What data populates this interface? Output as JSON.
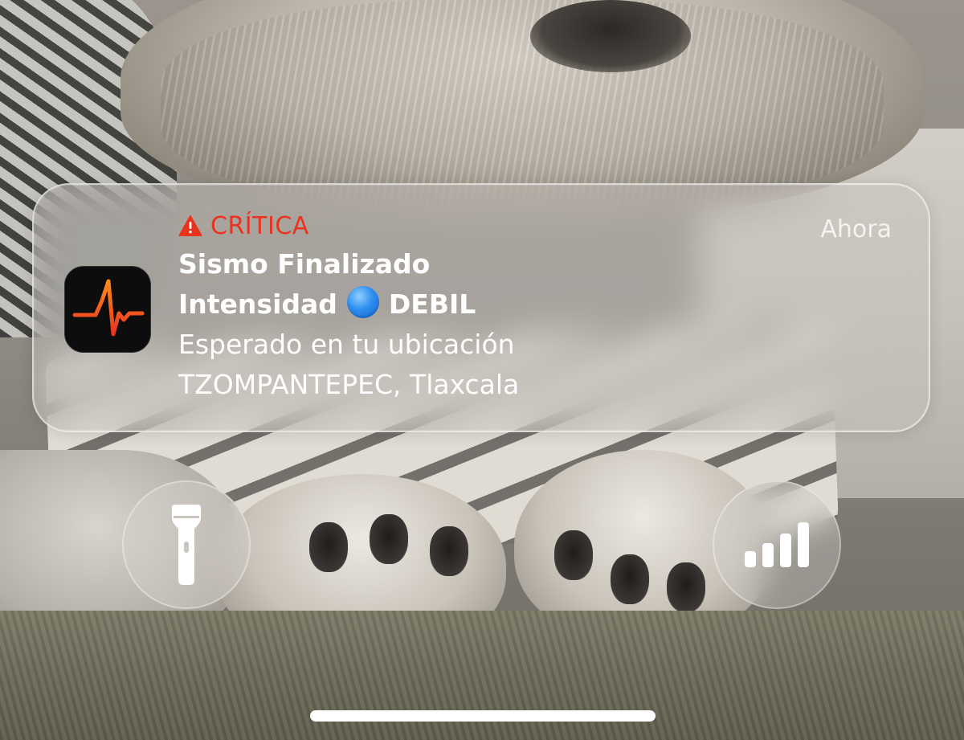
{
  "notification": {
    "app_icon": "seismic-waveform-icon",
    "severity_icon": "warning-triangle-icon",
    "severity": "CRÍTICA",
    "timestamp": "Ahora",
    "title": "Sismo Finalizado",
    "intensity_label": "Intensidad",
    "intensity_indicator": "blue-circle-emoji",
    "intensity_level": "DEBIL",
    "message": "Esperado en tu ubicación",
    "location": "TZOMPANTEPEC, Tlaxcala"
  },
  "lock_screen": {
    "left_button_icon": "flashlight-icon",
    "right_button_icon": "signal-bars-icon"
  },
  "colors": {
    "critical": "#e8331f",
    "intensity_dot": "#2f8ff0",
    "app_icon_bg": "#0d0d0d",
    "waveform": "#ff7a1a"
  }
}
